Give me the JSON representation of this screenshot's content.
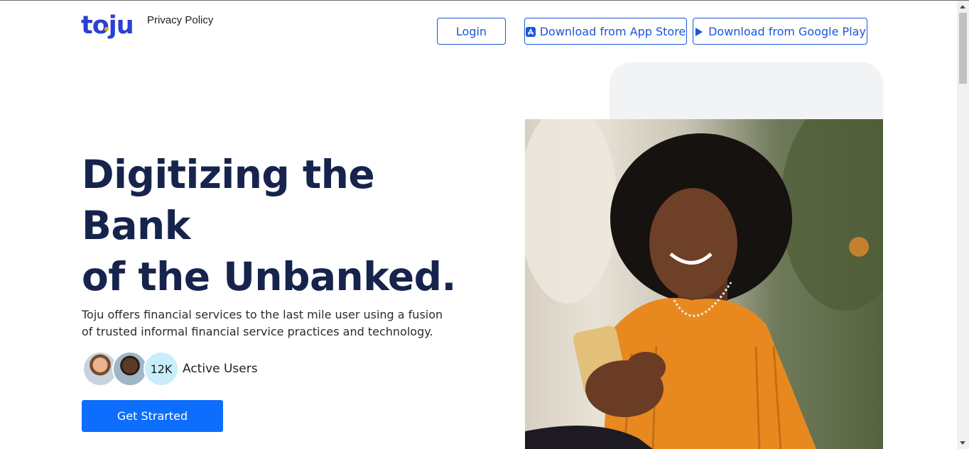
{
  "header": {
    "logo_text": "toju",
    "privacy_link": "Privacy Policy",
    "login_label": "Login",
    "appstore_label": "Download from App Store",
    "play_label": "Download from Google Play"
  },
  "hero": {
    "title_lines": [
      "Digitizing the",
      "Bank",
      "of the Unbanked."
    ],
    "description": "Toju offers financial services to the last mile user using a fusion of trusted informal financial service practices and technology.",
    "users_count": "12K",
    "users_label": "Active Users",
    "cta_label": "Get Strarted"
  },
  "colors": {
    "brand_blue": "#2a3fd4",
    "accent_blue": "#1a56db",
    "primary_button": "#0d6efd",
    "title_navy": "#16244d",
    "users_bubble": "#c9eefb"
  },
  "icons": {
    "appstore": "app-store-icon",
    "play": "google-play-icon"
  }
}
